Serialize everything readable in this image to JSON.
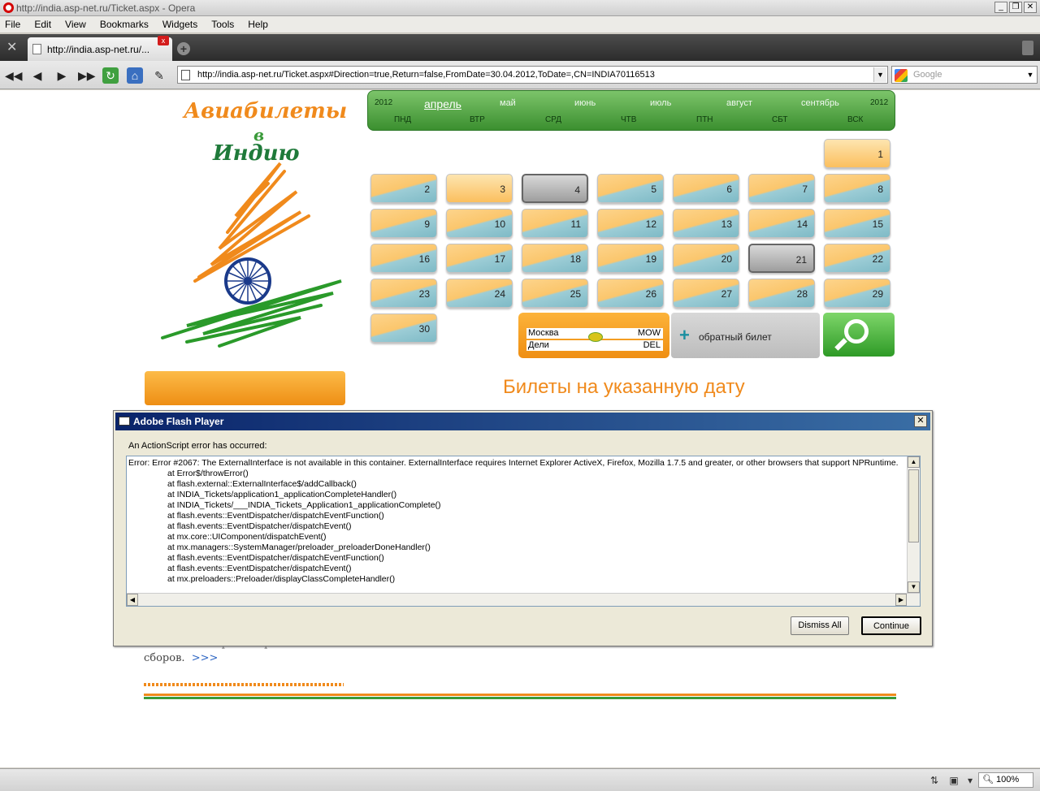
{
  "window": {
    "title": "http://india.asp-net.ru/Ticket.aspx - Opera",
    "controls": [
      "_",
      "❐",
      "✕"
    ]
  },
  "menu": [
    "File",
    "Edit",
    "View",
    "Bookmarks",
    "Widgets",
    "Tools",
    "Help"
  ],
  "tab": {
    "label": "http://india.asp-net.ru/...",
    "close": "x",
    "new_tab": "+"
  },
  "toolbar": {
    "url": "http://india.asp-net.ru/Ticket.aspx#Direction=true,Return=false,FromDate=30.04.2012,ToDate=,CN=INDIA70116513",
    "search_placeholder": "Google",
    "icons": [
      "rewind-icon",
      "back-icon",
      "forward-icon",
      "fast-forward-icon",
      "reload-icon",
      "home-icon",
      "edit-icon"
    ]
  },
  "logo": {
    "line1": "Авиабилеты",
    "line2": "в",
    "line3": "Индию"
  },
  "calendar": {
    "year_left": "2012",
    "year_right": "2012",
    "months": [
      {
        "label": "апрель",
        "active": true
      },
      {
        "label": "май",
        "active": false
      },
      {
        "label": "июнь",
        "active": false
      },
      {
        "label": "июль",
        "active": false
      },
      {
        "label": "август",
        "active": false
      },
      {
        "label": "сентябрь",
        "active": false
      }
    ],
    "weekdays": [
      "ПНД",
      "ВТР",
      "СРД",
      "ЧТВ",
      "ПТН",
      "СБТ",
      "ВСК"
    ],
    "days": [
      {
        "n": "1",
        "style": "plain"
      },
      {
        "n": "2",
        "style": "split"
      },
      {
        "n": "3",
        "style": "plain"
      },
      {
        "n": "4",
        "style": "grey"
      },
      {
        "n": "5",
        "style": "split"
      },
      {
        "n": "6",
        "style": "split"
      },
      {
        "n": "7",
        "style": "split"
      },
      {
        "n": "8",
        "style": "split"
      },
      {
        "n": "9",
        "style": "split"
      },
      {
        "n": "10",
        "style": "split"
      },
      {
        "n": "11",
        "style": "split"
      },
      {
        "n": "12",
        "style": "split"
      },
      {
        "n": "13",
        "style": "split"
      },
      {
        "n": "14",
        "style": "split"
      },
      {
        "n": "15",
        "style": "split"
      },
      {
        "n": "16",
        "style": "split"
      },
      {
        "n": "17",
        "style": "split"
      },
      {
        "n": "18",
        "style": "split"
      },
      {
        "n": "19",
        "style": "split"
      },
      {
        "n": "20",
        "style": "split"
      },
      {
        "n": "21",
        "style": "grey"
      },
      {
        "n": "22",
        "style": "split"
      },
      {
        "n": "23",
        "style": "split"
      },
      {
        "n": "24",
        "style": "split"
      },
      {
        "n": "25",
        "style": "split"
      },
      {
        "n": "26",
        "style": "split"
      },
      {
        "n": "27",
        "style": "split"
      },
      {
        "n": "28",
        "style": "split"
      },
      {
        "n": "29",
        "style": "split"
      },
      {
        "n": "30",
        "style": "split"
      }
    ]
  },
  "route": {
    "from_city": "Москва",
    "from_code": "MOW",
    "to_city": "Дели",
    "to_code": "DEL",
    "return_label": "обратный билет"
  },
  "content": {
    "heading": "Билеты на указанную дату",
    "body_clipped": "такжесте ст крв ичльрачест несте",
    "body_text": "сборов.",
    "more_link": ">>>"
  },
  "dialog": {
    "title": "Adobe Flash Player",
    "message": "An ActionScript error has occurred:",
    "error_lines": [
      "Error: Error #2067: The ExternalInterface is not available in this container. ExternalInterface requires Internet Explorer ActiveX, Firefox, Mozilla 1.7.5 and greater, or other browsers that support NPRuntime.",
      "\tat Error$/throwError()",
      "\tat flash.external::ExternalInterface$/addCallback()",
      "\tat INDIA_Tickets/application1_applicationCompleteHandler()",
      "\tat INDIA_Tickets/___INDIA_Tickets_Application1_applicationComplete()",
      "\tat flash.events::EventDispatcher/dispatchEventFunction()",
      "\tat flash.events::EventDispatcher/dispatchEvent()",
      "\tat mx.core::UIComponent/dispatchEvent()",
      "\tat mx.managers::SystemManager/preloader_preloaderDoneHandler()",
      "\tat flash.events::EventDispatcher/dispatchEventFunction()",
      "\tat flash.events::EventDispatcher/dispatchEvent()",
      "\tat mx.preloaders::Preloader/displayClassCompleteHandler()"
    ],
    "dismiss_label": "Dismiss All",
    "continue_label": "Continue"
  },
  "status": {
    "zoom": "100%"
  }
}
